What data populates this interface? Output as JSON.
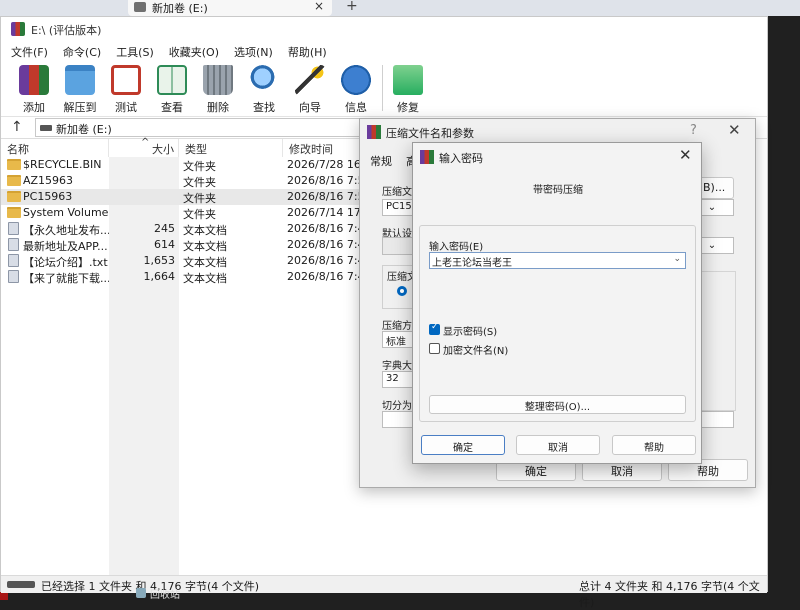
{
  "browser": {
    "tab_title": "新加卷 (E:)",
    "close": "×",
    "new_tab": "+"
  },
  "window": {
    "title": "E:\\ (评估版本)"
  },
  "menu": [
    "文件(F)",
    "命令(C)",
    "工具(S)",
    "收藏夹(O)",
    "选项(N)",
    "帮助(H)"
  ],
  "toolbar": [
    {
      "label": "添加",
      "icon": "add-archive-icon",
      "color": "#8e44ad"
    },
    {
      "label": "解压到",
      "icon": "extract-folder-icon",
      "color": "#3b82c4"
    },
    {
      "label": "测试",
      "icon": "test-checklist-icon",
      "color": "#c0392b"
    },
    {
      "label": "查看",
      "icon": "view-book-icon",
      "color": "#2e8b57"
    },
    {
      "label": "删除",
      "icon": "delete-bin-icon",
      "color": "#7f8c8d"
    },
    {
      "label": "查找",
      "icon": "find-magnifier-icon",
      "color": "#2b6cb0"
    },
    {
      "label": "向导",
      "icon": "wizard-wand-icon",
      "color": "#d4a017"
    },
    {
      "label": "信息",
      "icon": "info-icon",
      "color": "#1f5fa8"
    },
    {
      "label": "修复",
      "icon": "repair-icon",
      "color": "#27ae60"
    }
  ],
  "address": {
    "up": "↑",
    "path": "新加卷 (E:)"
  },
  "columns": {
    "name": "名称",
    "size": "大小",
    "type": "类型",
    "date": "修改时间",
    "sort": "^"
  },
  "files": [
    {
      "name": "$RECYCLE.BIN",
      "size": "",
      "type": "文件夹",
      "date": "2026/7/28 16:",
      "kind": "folder"
    },
    {
      "name": "AZ15963",
      "size": "",
      "type": "文件夹",
      "date": "2026/8/16 7:5",
      "kind": "folder"
    },
    {
      "name": "PC15963",
      "size": "",
      "type": "文件夹",
      "date": "2026/8/16 7:5",
      "kind": "folder",
      "selected": true
    },
    {
      "name": "System Volume...",
      "size": "",
      "type": "文件夹",
      "date": "2026/7/14 17:",
      "kind": "folder"
    },
    {
      "name": "【永久地址发布...",
      "size": "245",
      "type": "文本文档",
      "date": "2026/8/16 7:4",
      "kind": "doc"
    },
    {
      "name": "最新地址及APP...",
      "size": "614",
      "type": "文本文档",
      "date": "2026/8/16 7:4",
      "kind": "doc"
    },
    {
      "name": "【论坛介绍】.txt",
      "size": "1,653",
      "type": "文本文档",
      "date": "2026/8/16 7:4",
      "kind": "doc"
    },
    {
      "name": "【来了就能下载...",
      "size": "1,664",
      "type": "文本文档",
      "date": "2026/8/16 7:4",
      "kind": "doc"
    }
  ],
  "status": {
    "left": "已经选择 1 文件夹 和 4,176 字节(4 个文件)",
    "right": "总计 4 文件夹 和 4,176 字节(4 个文件)"
  },
  "taskbar": {
    "recycle": "回收站"
  },
  "params_dialog": {
    "title": "压缩文件名和参数",
    "help": "?",
    "close": "✕",
    "tab_general": "常规",
    "tab_adv": "高",
    "archive_name_label": "压缩文件",
    "archive_name_value": "PC159",
    "browse": "(B)...",
    "default_label": "默认设置",
    "format_label": "压缩文",
    "method_label": "压缩方式",
    "method_value": "标准",
    "dict_label": "字典大小",
    "dict_value": "32",
    "split_label": "切分为分",
    "ok": "确定",
    "cancel": "取消",
    "help_btn": "帮助"
  },
  "password_dialog": {
    "title": "输入密码",
    "close": "✕",
    "subtitle": "带密码压缩",
    "enter_label": "输入密码(E)",
    "password_value": "上老王论坛当老王",
    "dropdown": "⌄",
    "show_password": "显示密码(S)",
    "show_password_checked": true,
    "encrypt_names": "加密文件名(N)",
    "encrypt_names_checked": false,
    "organize": "整理密码(O)...",
    "ok": "确定",
    "cancel": "取消",
    "help": "帮助"
  }
}
